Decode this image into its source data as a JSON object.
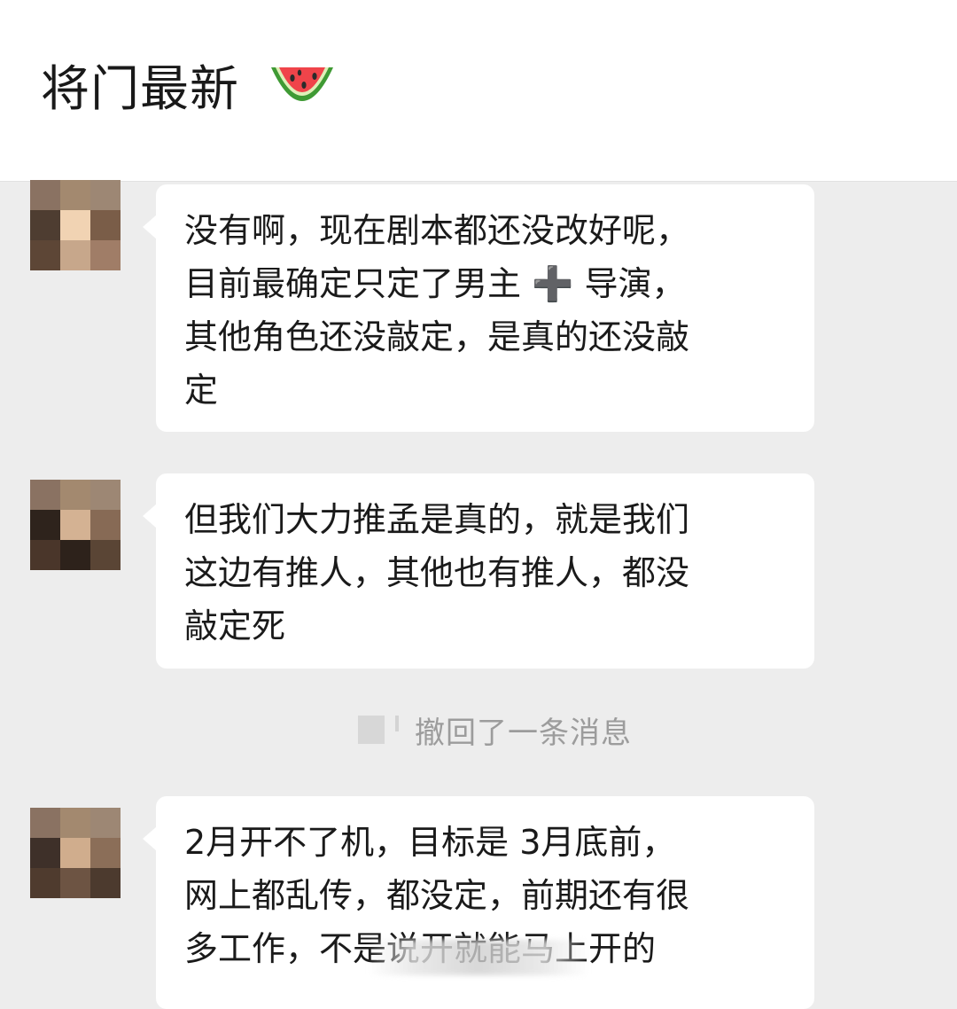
{
  "header": {
    "title": "将门最新"
  },
  "messages": [
    {
      "text": "没有啊，现在剧本都还没改好呢，\n目前最确定只定了男主 ➕ 导演，\n其他角色还没敲定，是真的还没敲\n定"
    },
    {
      "text": "但我们大力推孟是真的，就是我们\n这边有推人，其他也有推人，都没\n敲定死"
    },
    {
      "text": "2月开不了机，目标是 3月底前，\n网上都乱传，都没定，前期还有很\n多工作，不是说开就能马上开的"
    }
  ],
  "system_notice": {
    "text": "撤回了一条消息"
  },
  "colors": {
    "background": "#ededed",
    "header_bg": "#ffffff",
    "bubble_bg": "#ffffff",
    "text": "#1a1a1a",
    "notice_text": "#9c9c9c"
  },
  "icons": {
    "title_emoji": "watermelon-icon",
    "avatars": "pixelated-avatar"
  }
}
